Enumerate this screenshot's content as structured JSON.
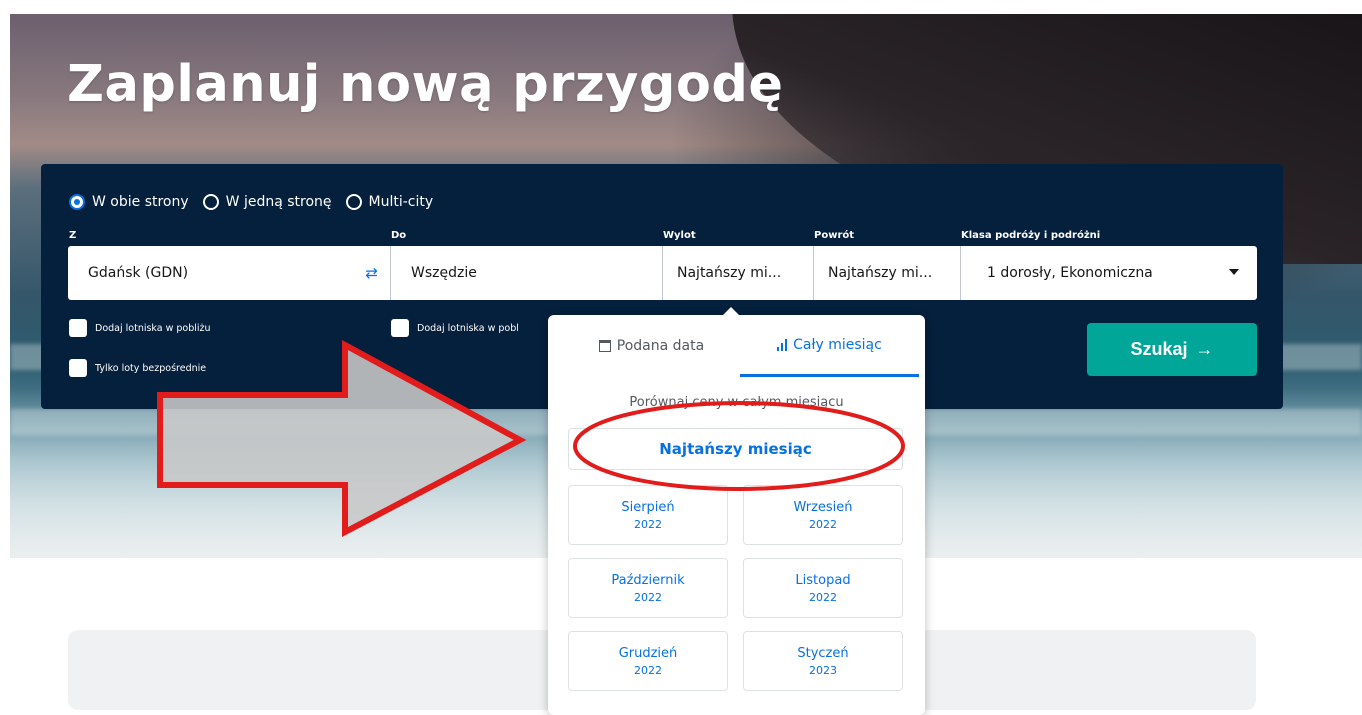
{
  "hero": {
    "title": "Zaplanuj nową przygodę"
  },
  "search": {
    "trip_types": [
      {
        "label": "W obie strony",
        "checked": true
      },
      {
        "label": "W jedną stronę",
        "checked": false
      },
      {
        "label": "Multi-city",
        "checked": false
      }
    ],
    "from": {
      "label": "Z",
      "value": "Gdańsk (GDN)"
    },
    "to": {
      "label": "Do",
      "value": "Wszędzie"
    },
    "depart": {
      "label": "Wylot",
      "value": "Najtańszy mi..."
    },
    "return": {
      "label": "Powrót",
      "value": "Najtańszy mi..."
    },
    "cabin": {
      "label": "Klasa podróży i podróżni",
      "value": "1 dorosły, Ekonomiczna"
    },
    "nearby_from_label": "Dodaj lotniska w pobliżu",
    "nearby_to_label": "Dodaj lotniska w pobl",
    "direct_label": "Tylko loty bezpośrednie",
    "search_button": "Szukaj",
    "search_arrow": "→",
    "swap_icon": "⇄"
  },
  "date_popup": {
    "tab_specific": "Podana data",
    "tab_month": "Cały miesiąc",
    "hint": "Porównaj ceny w całym miesiącu",
    "cheapest": "Najtańszy miesiąc",
    "months": [
      {
        "name": "Sierpień",
        "year": "2022"
      },
      {
        "name": "Wrzesień",
        "year": "2022"
      },
      {
        "name": "Październik",
        "year": "2022"
      },
      {
        "name": "Listopad",
        "year": "2022"
      },
      {
        "name": "Grudzień",
        "year": "2022"
      },
      {
        "name": "Styczeń",
        "year": "2023"
      }
    ]
  },
  "colors": {
    "panel": "#05203c",
    "accent_blue": "#0770e3",
    "search_teal": "#00a698",
    "annotation_red": "#e21b1b"
  }
}
